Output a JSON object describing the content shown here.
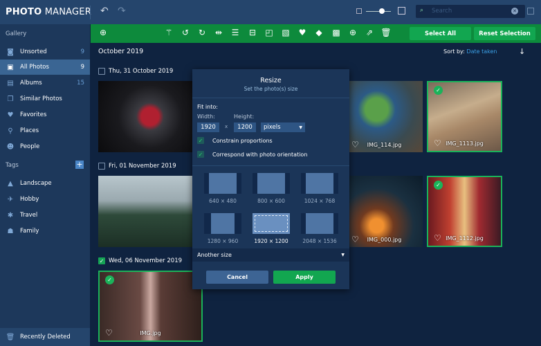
{
  "app": {
    "title_bold": "PHOTO",
    "title_rest": "MANAGER"
  },
  "header": {
    "search_placeholder": "Search"
  },
  "sidebar": {
    "gallery_label": "Gallery",
    "items": [
      {
        "label": "Unsorted",
        "count": "9"
      },
      {
        "label": "All Photos",
        "count": "9"
      },
      {
        "label": "Albums",
        "count": "15"
      },
      {
        "label": "Similar Photos"
      },
      {
        "label": "Favorites"
      },
      {
        "label": "Places"
      },
      {
        "label": "People"
      }
    ],
    "tags_label": "Tags",
    "tags": [
      {
        "label": "Landscape"
      },
      {
        "label": "Hobby"
      },
      {
        "label": "Travel"
      },
      {
        "label": "Family"
      }
    ],
    "recently_deleted": "Recently Deleted"
  },
  "toolbar": {
    "select_all": "Select All",
    "reset_selection": "Reset Selection"
  },
  "main": {
    "month": "October 2019",
    "sort_label": "Sort by:",
    "sort_value": "Date taken",
    "groups": [
      {
        "date": "Thu, 31 October 2019"
      },
      {
        "date": "Fri, 01 November 2019"
      },
      {
        "date": "Wed, 06 November 2019"
      }
    ],
    "photos": [
      {
        "name": "IMG_114.jpg"
      },
      {
        "name": "IMG_1113.jpg"
      },
      {
        "name": "IMG_000.jpg"
      },
      {
        "name": "IMG_1112.jpg"
      },
      {
        "name": "IMG.jpg"
      }
    ]
  },
  "dialog": {
    "title": "Resize",
    "subtitle": "Set the photo(s) size",
    "fit_into": "Fit into:",
    "width_label": "Width:",
    "height_label": "Height:",
    "width": "1920",
    "x": "x",
    "height": "1200",
    "unit": "pixels",
    "constrain": "Constrain proportions",
    "orientation": "Correspond with photo orientation",
    "presets": [
      "640 × 480",
      "800 × 600",
      "1024 × 768",
      "1280 × 960",
      "1920 × 1200",
      "2048 × 1536"
    ],
    "another_size": "Another size",
    "cancel": "Cancel",
    "apply": "Apply"
  }
}
